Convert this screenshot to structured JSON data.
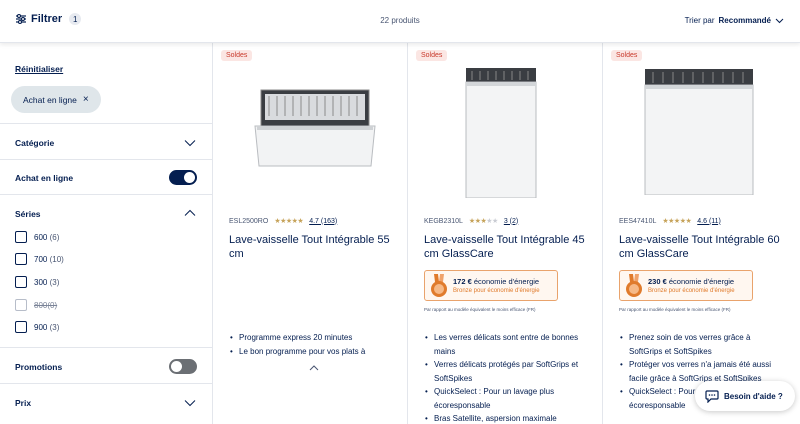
{
  "topbar": {
    "filter_label": "Filtrer",
    "filter_count": "1",
    "products_count": "22 produits",
    "sort_prefix": "Trier par",
    "sort_value": "Recommandé"
  },
  "sidebar": {
    "reset_label": "Réinitialiser",
    "active_chip": "Achat en ligne",
    "category_label": "Catégorie",
    "online_label": "Achat en ligne",
    "online_on": true,
    "series_label": "Séries",
    "series": [
      {
        "label": "600",
        "count": "(6)",
        "disabled": false
      },
      {
        "label": "700",
        "count": "(10)",
        "disabled": false
      },
      {
        "label": "300",
        "count": "(3)",
        "disabled": false
      },
      {
        "label": "800",
        "count": "(0)",
        "disabled": true
      },
      {
        "label": "900",
        "count": "(3)",
        "disabled": false
      }
    ],
    "promotions_label": "Promotions",
    "promotions_on": false,
    "price_label": "Prix"
  },
  "products": [
    {
      "badge": "Soldes",
      "sku": "ESL2500RO",
      "stars": 4.7,
      "rating": "4.7 (163)",
      "title": "Lave-vaisselle Tout Intégrable 55 cm",
      "bullets": [
        "Programme express 20 minutes",
        "Le bon programme pour vos plats à"
      ]
    },
    {
      "badge": "Soldes",
      "sku": "KEGB2310L",
      "stars": 3,
      "rating": "3 (2)",
      "title": "Lave-vaisselle Tout Intégrable 45 cm GlassCare",
      "energy_amount": "172 €",
      "energy_text": "économie d'énergie",
      "energy_sub": "Bronze pour économie d'énergie",
      "fineprint": "Par rapport au modèle équivalent le moins efficace (FR)",
      "bullets": [
        "Les verres délicats sont entre de bonnes mains",
        "Verres délicats protégés par SoftGrips et SoftSpikes",
        "QuickSelect : Pour un lavage plus écoresponsable",
        "Bras Satellite, aspersion maximale"
      ]
    },
    {
      "badge": "Soldes",
      "sku": "EES47410L",
      "stars": 4.6,
      "rating": "4.6 (11)",
      "title": "Lave-vaisselle Tout Intégrable 60 cm GlassCare",
      "energy_amount": "230 €",
      "energy_text": "économie d'énergie",
      "energy_sub": "Bronze pour économie d'énergie",
      "fineprint": "Par rapport au modèle équivalent le moins efficace (FR)",
      "bullets": [
        "Prenez soin de vos verres grâce à SoftGrips et SoftSpikes",
        "Protéger vos verres n'a jamais été aussi facile grâce à SoftGrips et SoftSpikes",
        "QuickSelect : Pour un lavage plus écoresponsable"
      ]
    }
  ],
  "help_label": "Besoin d'aide ?",
  "colors": {
    "navy": "#041e50",
    "sale_red": "#c8382a",
    "energy_orange": "#e07b2c",
    "star_gold": "#c6a35a"
  }
}
